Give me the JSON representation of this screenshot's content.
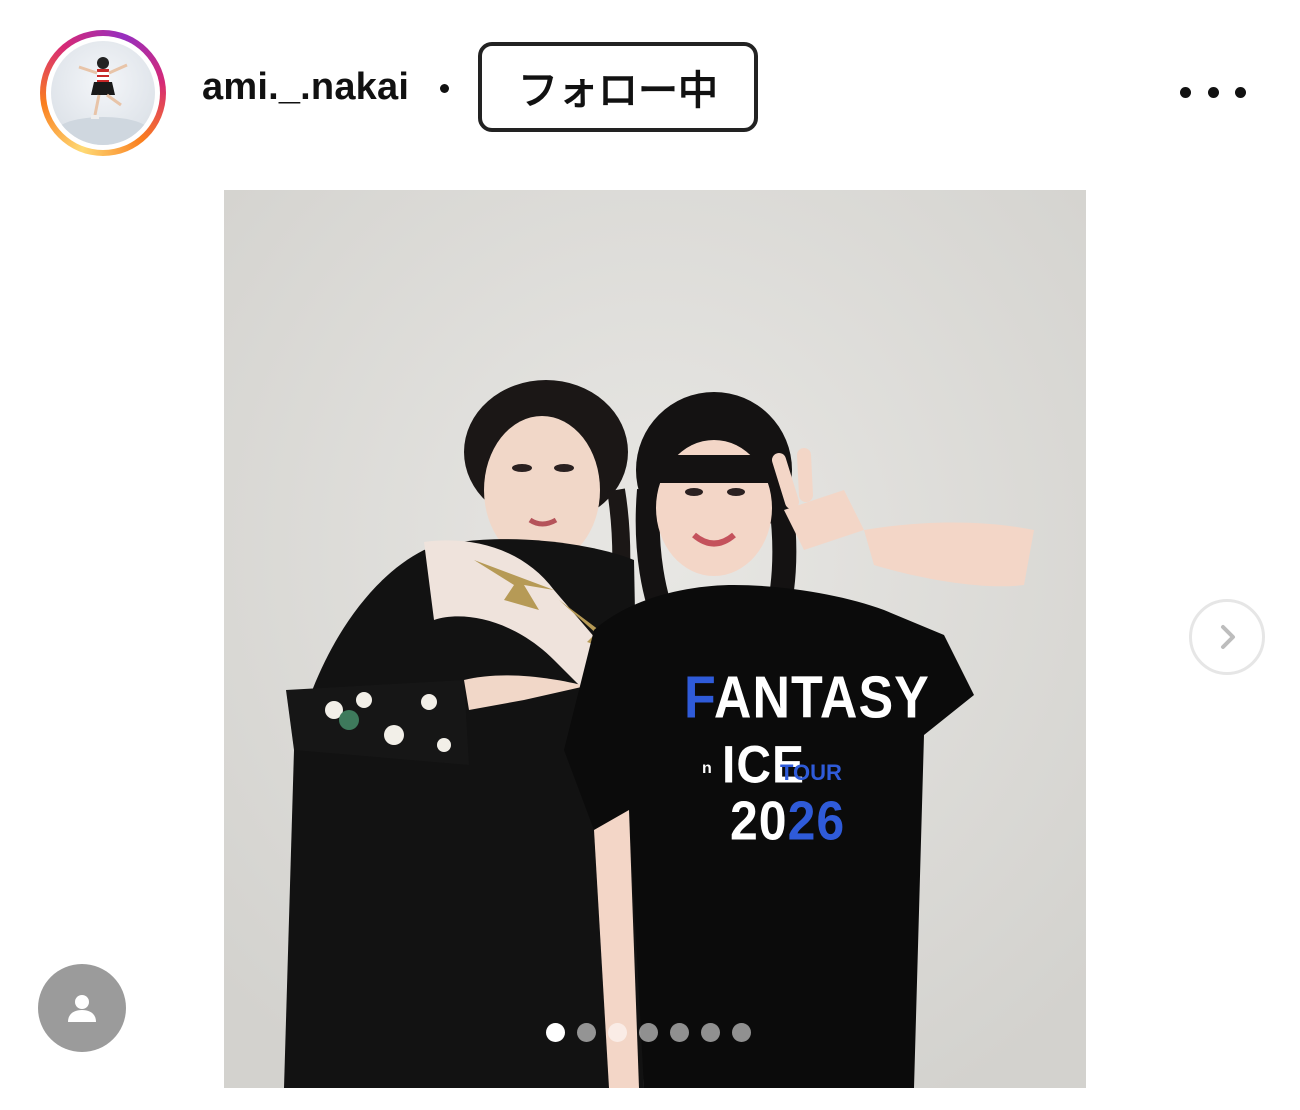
{
  "header": {
    "username": "ami._.nakai",
    "separator": "•",
    "follow_button_label": "フォロー中",
    "more_icon": "more-horizontal-icon",
    "avatar_icon": "profile-avatar"
  },
  "post": {
    "photo_alt": "photo",
    "shirt_print": {
      "line1": "FANTASY",
      "line2": "ICE",
      "line2_small": "TOUR",
      "line3": "2026",
      "in_mark": "n"
    },
    "carousel": {
      "total": 7,
      "active_index": 0
    },
    "next_icon": "chevron-right-icon",
    "tag_icon": "person-icon"
  },
  "colors": {
    "accent_blue": "#2f5bd9",
    "ring_colors": [
      "#feda75",
      "#fa7e1e",
      "#d62976",
      "#962fbf"
    ]
  }
}
